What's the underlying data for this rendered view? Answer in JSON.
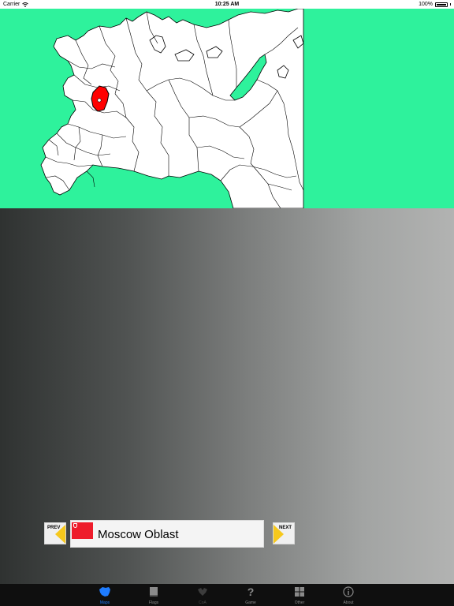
{
  "status_bar": {
    "carrier": "Carrier",
    "time": "10:25 AM",
    "battery": "100%"
  },
  "map": {
    "ocean_color": "#2ef29c",
    "land_color": "#ffffff",
    "highlight_color": "#ff0000"
  },
  "navigation": {
    "prev_label": "PREV",
    "next_label": "NEXT",
    "region_name": "Moscow Oblast"
  },
  "tab_bar": {
    "tabs": [
      {
        "label": "Maps",
        "icon": "map-icon",
        "state": "active"
      },
      {
        "label": "Flags",
        "icon": "flag-icon",
        "state": "normal"
      },
      {
        "label": "CoA",
        "icon": "coat-of-arms-icon",
        "state": "disabled"
      },
      {
        "label": "Game",
        "icon": "question-icon",
        "state": "normal"
      },
      {
        "label": "Other",
        "icon": "grid-icon",
        "state": "normal"
      },
      {
        "label": "About",
        "icon": "info-icon",
        "state": "normal"
      }
    ]
  }
}
